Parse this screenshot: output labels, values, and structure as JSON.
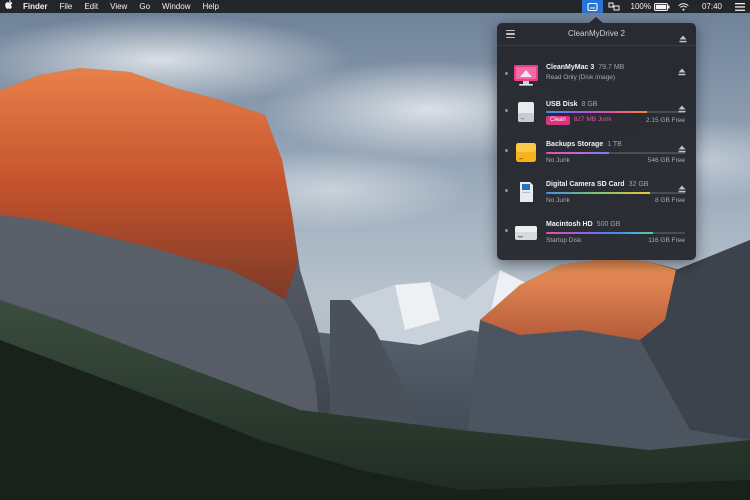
{
  "menubar": {
    "apple": "",
    "items": [
      {
        "label": "Finder"
      },
      {
        "label": "File"
      },
      {
        "label": "Edit"
      },
      {
        "label": "View"
      },
      {
        "label": "Go"
      },
      {
        "label": "Window"
      },
      {
        "label": "Help"
      }
    ],
    "battery_percent": "100%",
    "clock": "07:40",
    "active_color": "#2a73d6"
  },
  "popover": {
    "title": "CleanMyDrive 2",
    "accent": "#d9347f",
    "disks": [
      {
        "name": "CleanMyMac 3",
        "size": "79.7 MB",
        "status": "Read Only (Disk image)",
        "free": "",
        "icon": "disk-image-icon",
        "bar_fill": 0,
        "ejectable": true
      },
      {
        "name": "USB Disk",
        "size": "8 GB",
        "clean_label": "Clean",
        "junk": "827 MB Junk",
        "free": "2.15 GB Free",
        "icon": "usb-drive-icon",
        "bar_fill": 0.73,
        "ejectable": true
      },
      {
        "name": "Backups Storage",
        "size": "1 TB",
        "status": "No Junk",
        "free": "546 GB Free",
        "icon": "external-drive-icon",
        "bar_fill": 0.45,
        "ejectable": true
      },
      {
        "name": "Digital Camera SD Card",
        "size": "32 GB",
        "status": "No Junk",
        "free": "8 GB Free",
        "icon": "sd-card-icon",
        "bar_fill": 0.75,
        "ejectable": true
      },
      {
        "name": "Macintosh HD",
        "size": "500 GB",
        "status": "Startup Disk",
        "free": "116 GB Free",
        "icon": "internal-drive-icon",
        "bar_fill": 0.77,
        "ejectable": false
      }
    ]
  }
}
